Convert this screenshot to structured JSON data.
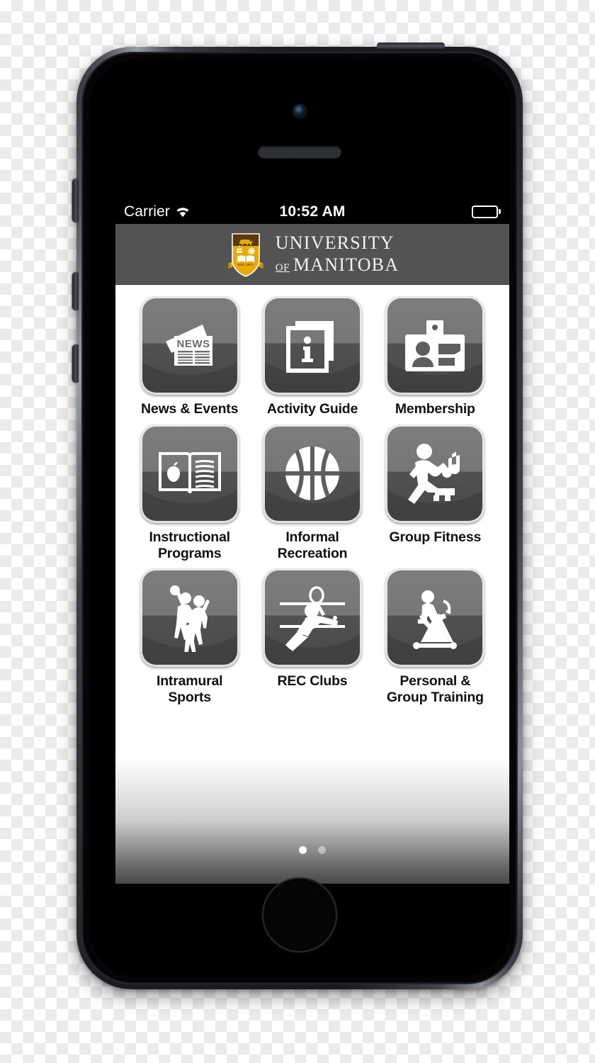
{
  "status_bar": {
    "carrier": "Carrier",
    "time": "10:52 AM",
    "wifi_icon": "wifi-icon",
    "battery_icon": "battery-full-icon"
  },
  "header": {
    "logo_icon": "university-of-manitoba-crest-icon",
    "brand_line1": "UNIVERSITY",
    "brand_of": "OF",
    "brand_line2": "MANITOBA",
    "crest_motto": "EST. 1877",
    "colors": {
      "header_background": "#535353",
      "crest_gold": "#e8a90c",
      "crest_brown": "#5a3a0f",
      "status_bar_background": "#000000"
    }
  },
  "grid": {
    "items": [
      {
        "label": "News & Events",
        "icon": "newspaper-icon",
        "label_lines": [
          "News & Events"
        ]
      },
      {
        "label": "Activity Guide",
        "icon": "info-documents-icon",
        "label_lines": [
          "Activity Guide"
        ]
      },
      {
        "label": "Membership",
        "icon": "id-badge-icon",
        "label_lines": [
          "Membership"
        ]
      },
      {
        "label": "Instructional Programs",
        "icon": "open-book-apple-icon",
        "label_lines": [
          "Instructional",
          "Programs"
        ]
      },
      {
        "label": "Informal Recreation",
        "icon": "basketball-icon",
        "label_lines": [
          "Informal",
          "Recreation"
        ]
      },
      {
        "label": "Group Fitness",
        "icon": "step-aerobics-music-icon",
        "label_lines": [
          "Group Fitness"
        ]
      },
      {
        "label": "Intramural Sports",
        "icon": "basketball-players-icon",
        "label_lines": [
          "Intramural",
          "Sports"
        ]
      },
      {
        "label": "REC Clubs",
        "icon": "racquet-player-icon",
        "label_lines": [
          "REC Clubs"
        ]
      },
      {
        "label": "Personal & Group Training",
        "icon": "exercise-bike-icon",
        "label_lines": [
          "Personal &",
          "Group Training"
        ]
      }
    ],
    "tile_colors": {
      "tile_top": "#6f6f6f",
      "tile_bottom": "#414141",
      "tile_border": "#f0f0f0",
      "icon_fill": "#ffffff",
      "label_color": "#111111"
    }
  },
  "pager": {
    "total_pages": 2,
    "current_page": 1,
    "dots": [
      "active",
      "inactive"
    ]
  },
  "device": {
    "hardware": {
      "camera": "front-camera",
      "speaker": "earpiece-speaker",
      "home_button": "home-button",
      "power_button": "power-button",
      "mute_switch": "mute-switch",
      "volume_up": "volume-up-button",
      "volume_down": "volume-down-button"
    }
  }
}
